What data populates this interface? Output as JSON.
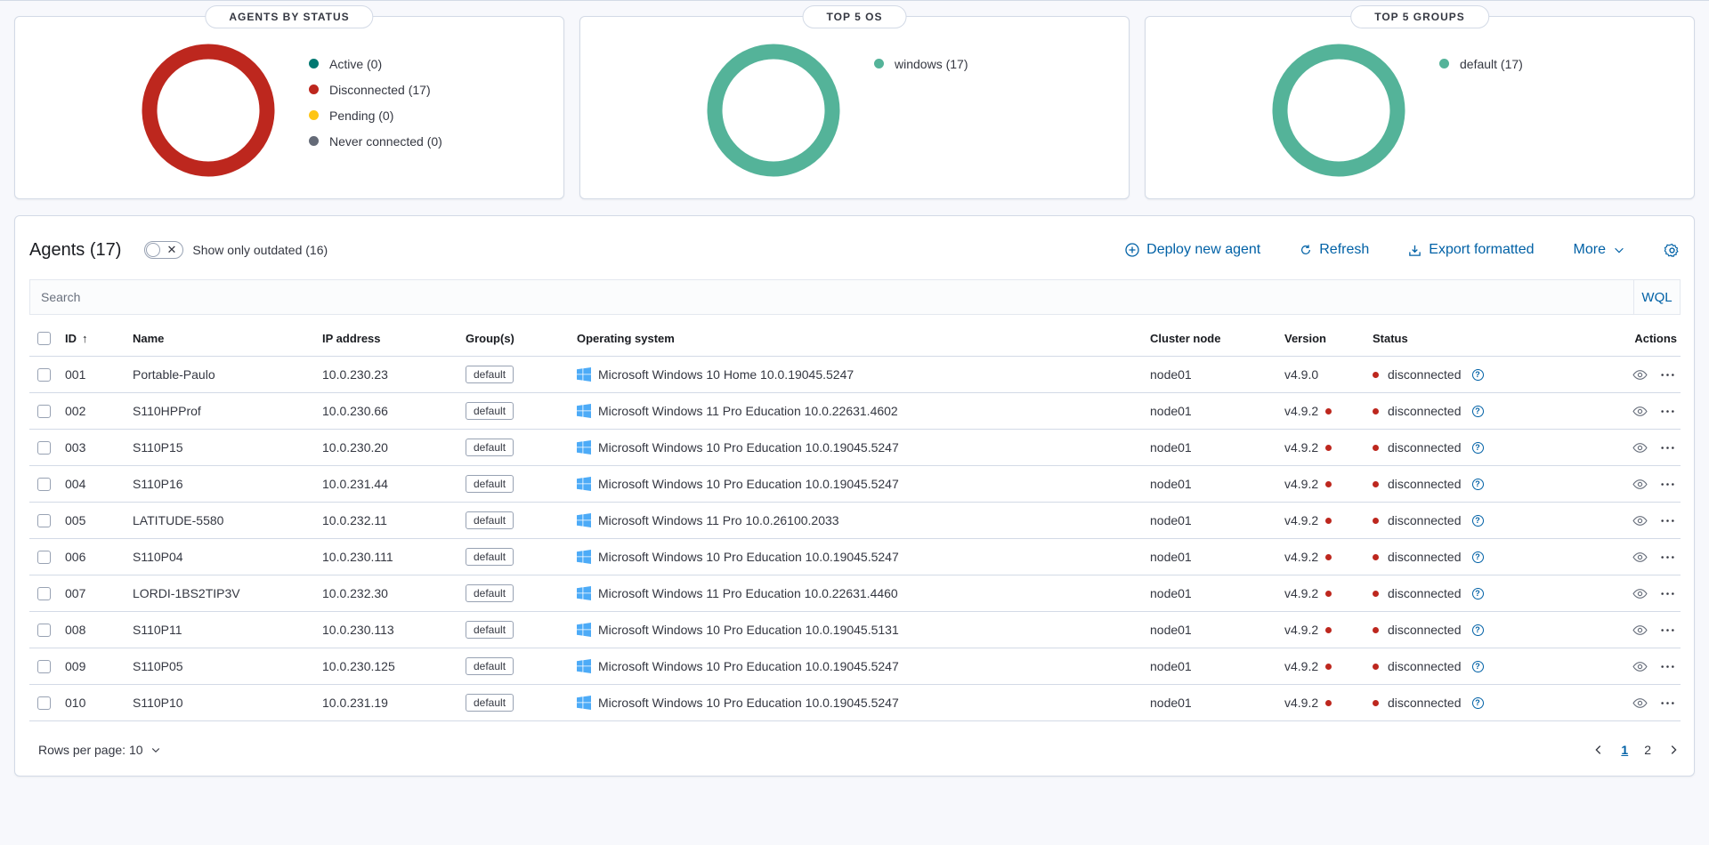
{
  "stats": [
    {
      "title": "AGENTS BY STATUS",
      "donut_color": "#bd271e",
      "legend": [
        {
          "label": "Active (0)",
          "color": "#007871"
        },
        {
          "label": "Disconnected (17)",
          "color": "#bd271e"
        },
        {
          "label": "Pending (0)",
          "color": "#fec514"
        },
        {
          "label": "Never connected (0)",
          "color": "#646a77"
        }
      ]
    },
    {
      "title": "TOP 5 OS",
      "donut_color": "#54b399",
      "legend": [
        {
          "label": "windows (17)",
          "color": "#54b399"
        }
      ]
    },
    {
      "title": "TOP 5 GROUPS",
      "donut_color": "#54b399",
      "legend": [
        {
          "label": "default (17)",
          "color": "#54b399"
        }
      ]
    }
  ],
  "agents": {
    "title": "Agents (17)",
    "toggle_label": "Show only outdated (16)",
    "actions": {
      "deploy": "Deploy new agent",
      "refresh": "Refresh",
      "export": "Export formatted",
      "more": "More"
    },
    "search_placeholder": "Search",
    "wql": "WQL",
    "columns": {
      "id": "ID",
      "name": "Name",
      "ip": "IP address",
      "groups": "Group(s)",
      "os": "Operating system",
      "node": "Cluster node",
      "version": "Version",
      "status": "Status",
      "actions": "Actions"
    },
    "rows": [
      {
        "id": "001",
        "name": "Portable-Paulo",
        "ip": "10.0.230.23",
        "group": "default",
        "os": "Microsoft Windows 10 Home 10.0.19045.5247",
        "node": "node01",
        "version": "v4.9.0",
        "outdated": false,
        "status": "disconnected"
      },
      {
        "id": "002",
        "name": "S110HPProf",
        "ip": "10.0.230.66",
        "group": "default",
        "os": "Microsoft Windows 11 Pro Education 10.0.22631.4602",
        "node": "node01",
        "version": "v4.9.2",
        "outdated": true,
        "status": "disconnected"
      },
      {
        "id": "003",
        "name": "S110P15",
        "ip": "10.0.230.20",
        "group": "default",
        "os": "Microsoft Windows 10 Pro Education 10.0.19045.5247",
        "node": "node01",
        "version": "v4.9.2",
        "outdated": true,
        "status": "disconnected"
      },
      {
        "id": "004",
        "name": "S110P16",
        "ip": "10.0.231.44",
        "group": "default",
        "os": "Microsoft Windows 10 Pro Education 10.0.19045.5247",
        "node": "node01",
        "version": "v4.9.2",
        "outdated": true,
        "status": "disconnected"
      },
      {
        "id": "005",
        "name": "LATITUDE-5580",
        "ip": "10.0.232.11",
        "group": "default",
        "os": "Microsoft Windows 11 Pro 10.0.26100.2033",
        "node": "node01",
        "version": "v4.9.2",
        "outdated": true,
        "status": "disconnected"
      },
      {
        "id": "006",
        "name": "S110P04",
        "ip": "10.0.230.111",
        "group": "default",
        "os": "Microsoft Windows 10 Pro Education 10.0.19045.5247",
        "node": "node01",
        "version": "v4.9.2",
        "outdated": true,
        "status": "disconnected"
      },
      {
        "id": "007",
        "name": "LORDI-1BS2TIP3V",
        "ip": "10.0.232.30",
        "group": "default",
        "os": "Microsoft Windows 11 Pro Education 10.0.22631.4460",
        "node": "node01",
        "version": "v4.9.2",
        "outdated": true,
        "status": "disconnected"
      },
      {
        "id": "008",
        "name": "S110P11",
        "ip": "10.0.230.113",
        "group": "default",
        "os": "Microsoft Windows 10 Pro Education 10.0.19045.5131",
        "node": "node01",
        "version": "v4.9.2",
        "outdated": true,
        "status": "disconnected"
      },
      {
        "id": "009",
        "name": "S110P05",
        "ip": "10.0.230.125",
        "group": "default",
        "os": "Microsoft Windows 10 Pro Education 10.0.19045.5247",
        "node": "node01",
        "version": "v4.9.2",
        "outdated": true,
        "status": "disconnected"
      },
      {
        "id": "010",
        "name": "S110P10",
        "ip": "10.0.231.19",
        "group": "default",
        "os": "Microsoft Windows 10 Pro Education 10.0.19045.5247",
        "node": "node01",
        "version": "v4.9.2",
        "outdated": true,
        "status": "disconnected"
      }
    ],
    "footer": {
      "rows_per_page": "Rows per page: 10",
      "pages": [
        "1",
        "2"
      ],
      "current_page": "1"
    }
  }
}
